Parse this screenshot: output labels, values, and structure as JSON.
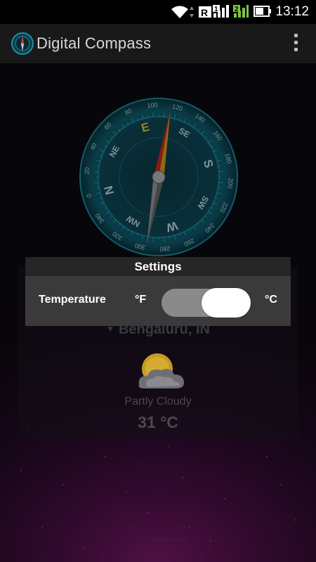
{
  "status_bar": {
    "time": "13:12"
  },
  "action_bar": {
    "title": "Digital Compass"
  },
  "compass": {
    "cardinals": [
      "E",
      "SE",
      "S",
      "SW",
      "W",
      "NW",
      "N",
      "NE"
    ],
    "degree_labels": [
      "0",
      "20",
      "40",
      "60",
      "80",
      "100",
      "120",
      "140",
      "160",
      "180",
      "200",
      "220",
      "240",
      "260",
      "280",
      "300",
      "320",
      "340"
    ],
    "accent": "#1c8fa0"
  },
  "weather": {
    "location": "Bengaluru, IN",
    "condition": "Partly Cloudy",
    "temperature": "31 °C"
  },
  "settings_dialog": {
    "title": "Settings",
    "temperature_label": "Temperature",
    "fahrenheit_label": "°F",
    "celsius_label": "°C",
    "toggle_on": true
  }
}
